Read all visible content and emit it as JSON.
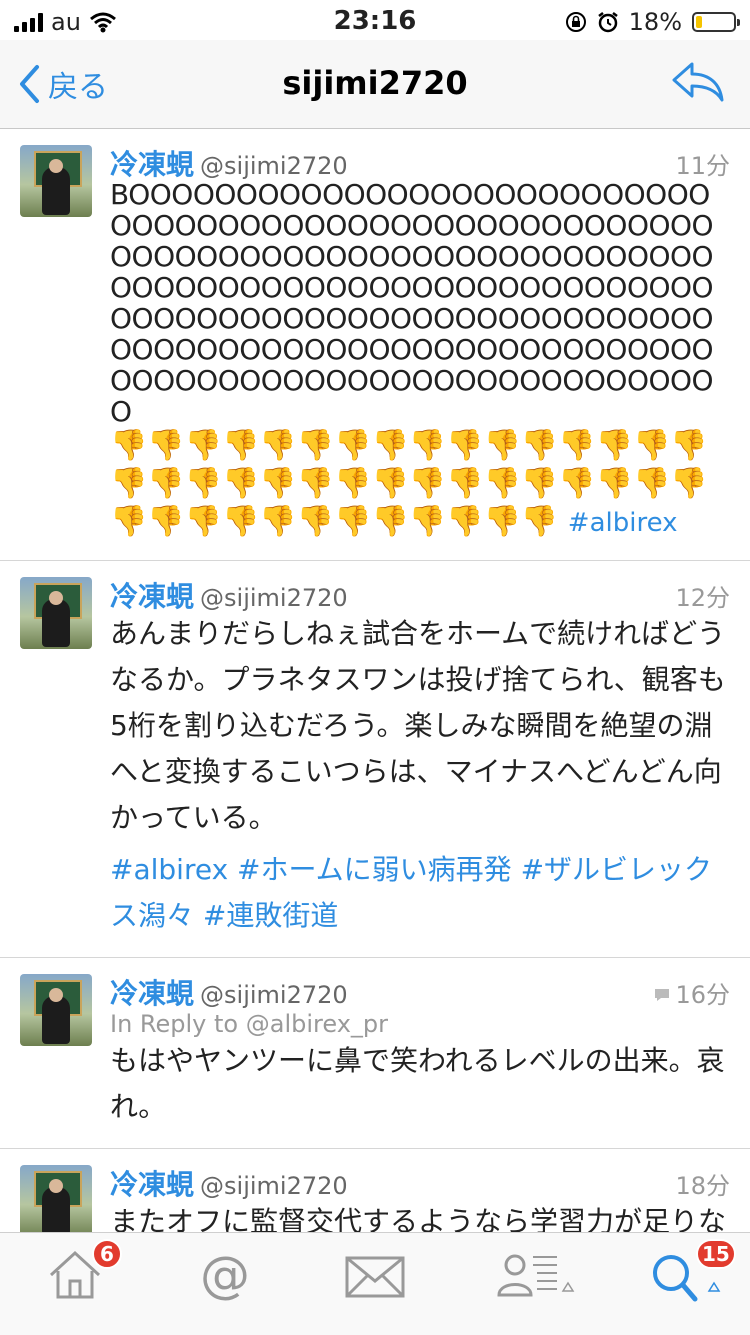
{
  "status_bar": {
    "carrier": "au",
    "time": "23:16",
    "battery": "18%",
    "battery_level": 0.18
  },
  "nav": {
    "back_label": "戻る",
    "title": "sijimi2720"
  },
  "tweets": [
    {
      "name": "冷凍蜆",
      "handle": "@sijimi2720",
      "time": "11分",
      "boo": "BOOOOOOOOOOOOOOOOOOOOOOOOOOOOOOOOOOOOOOOOOOOOOOOOOOOOOOOOOOOOOOOOOOOOOOOOOOOOOOOOOOOOOOOOOOOOOOOOOOOOOOOOOOOOOOOOOOOOOOOOOOOOOOOOOOOOOOOOOOOOOOOOOOOOOOOOOOOOOOOOOOOOOOOOOOOOOOOOOOOOOOOOOOOOOOOOOOOO",
      "emoji": "👎👎👎👎👎👎👎👎👎👎👎👎👎👎👎👎👎👎👎👎👎👎👎👎👎👎👎👎👎👎👎👎👎👎👎👎👎👎👎👎👎👎👎👎",
      "hashtag": "#albirex"
    },
    {
      "name": "冷凍蜆",
      "handle": "@sijimi2720",
      "time": "12分",
      "text": "あんまりだらしねぇ試合をホームで続ければどうなるか。プラネタスワンは投げ捨てられ、観客も5桁を割り込むだろう。楽しみな瞬間を絶望の淵へと変換するこいつらは、マイナスへどんどん向かっている。",
      "hashtags": "#albirex #ホームに弱い病再発 #ザルビレックス潟々 #連敗街道"
    },
    {
      "name": "冷凍蜆",
      "handle": "@sijimi2720",
      "time": "16分",
      "in_reply": "In Reply to @albirex_pr",
      "text": "もはやヤンツーに鼻で笑われるレベルの出来。哀れ。"
    },
    {
      "name": "冷凍蜆",
      "handle": "@sijimi2720",
      "time": "18分",
      "text": "またオフに監督交代するようなら学習力が足りないとみなすぞ。チームがバラバラなのは短期的に治癒するような病気ではない。"
    }
  ],
  "tabbar": {
    "home_badge": "6",
    "at_symbol": "@",
    "search_badge": "15"
  },
  "colors": {
    "accent": "#2f8de0",
    "badge": "#e23b2e",
    "battery": "#f5c400"
  }
}
